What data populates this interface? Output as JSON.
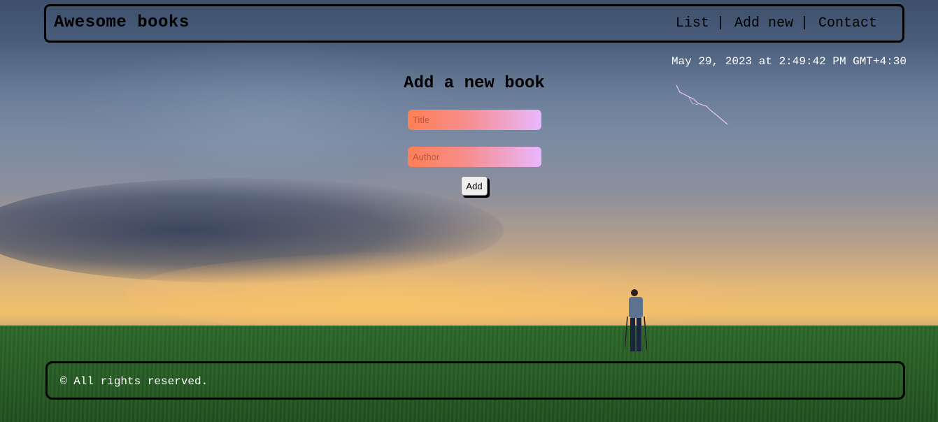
{
  "header": {
    "brand": "Awesome books",
    "nav": [
      {
        "label": "List",
        "separator": "|"
      },
      {
        "label": "Add new",
        "separator": "|"
      },
      {
        "label": "Contact"
      }
    ]
  },
  "datetime": "May 29, 2023 at 2:49:42 PM GMT+4:30",
  "form": {
    "heading": "Add a new book",
    "title_placeholder": "Title",
    "author_placeholder": "Author",
    "submit_label": "Add"
  },
  "footer": {
    "copyright": "© All rights reserved."
  },
  "colors": {
    "input_gradient_start": "#ff7f55",
    "input_gradient_end": "#e9b7ff",
    "border": "#000000"
  }
}
